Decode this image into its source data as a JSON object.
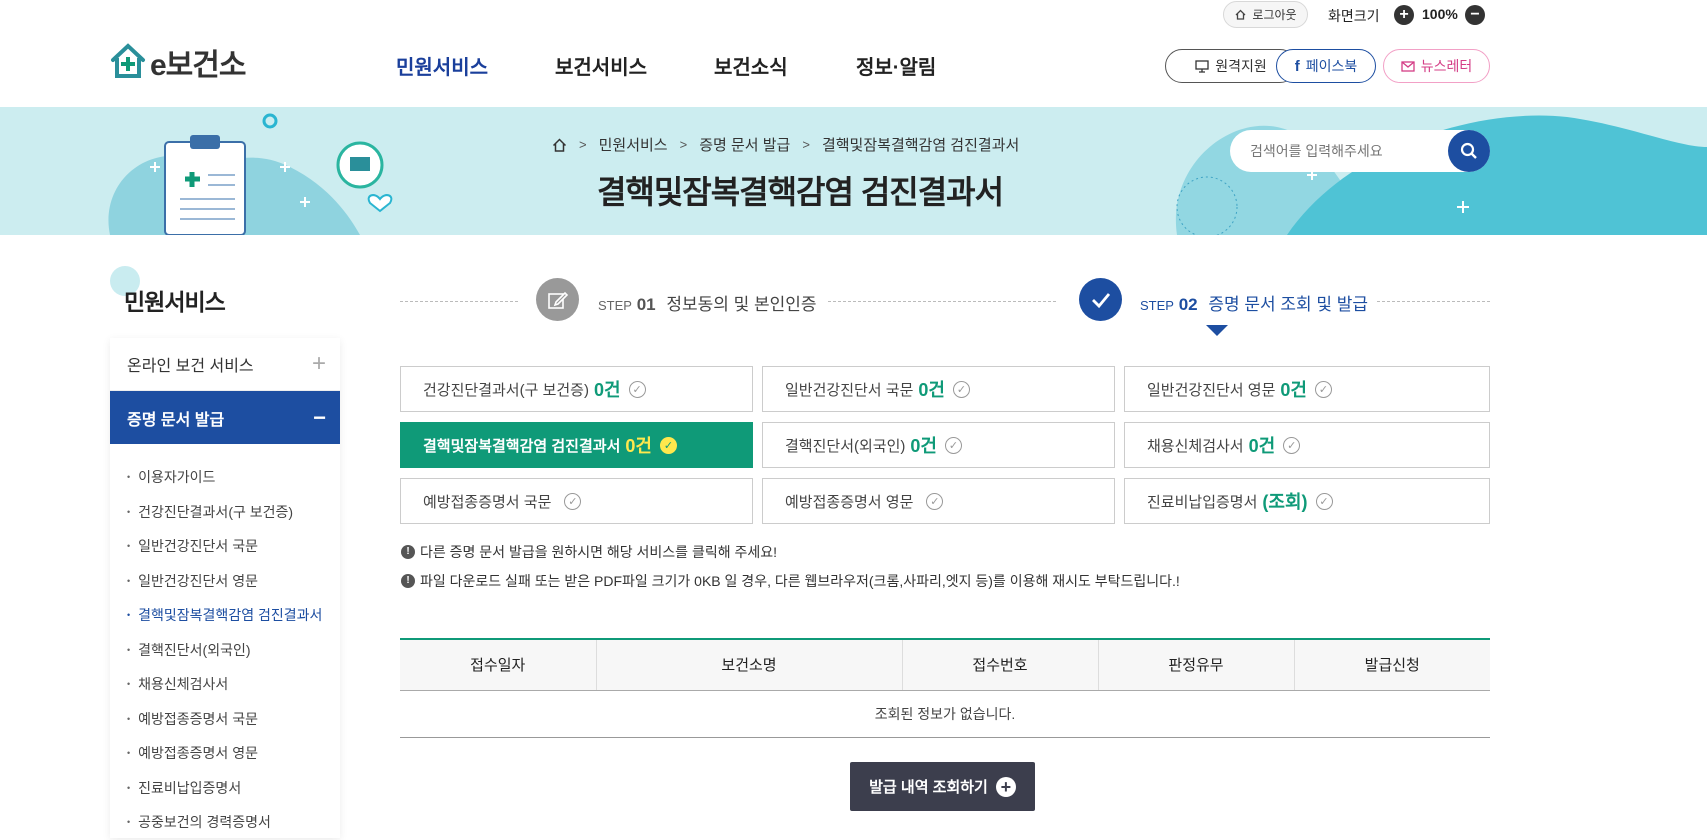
{
  "util": {
    "logout": "로그아웃",
    "screen_size": "화면크기",
    "zoom": "100%"
  },
  "logo": {
    "text": "e보건소"
  },
  "gnb": [
    "민원서비스",
    "보건서비스",
    "보건소식",
    "정보·알림"
  ],
  "header_buttons": {
    "remote": "원격지원",
    "facebook": "페이스북",
    "newsletter": "뉴스레터"
  },
  "breadcrumb": [
    "민원서비스",
    "증명 문서 발급",
    "결핵및잠복결핵감염 검진결과서"
  ],
  "page_title": "결핵및잠복결핵감염 검진결과서",
  "search": {
    "placeholder": "검색어를 입력해주세요"
  },
  "sidebar": {
    "title": "민원서비스",
    "sections": [
      {
        "label": "온라인 보건 서비스",
        "toggle": "+"
      },
      {
        "label": "증명 문서 발급",
        "toggle": "−"
      }
    ],
    "items": [
      "이용자가이드",
      "건강진단결과서(구 보건증)",
      "일반건강진단서 국문",
      "일반건강진단서 영문",
      "결핵및잠복결핵감염 검진결과서",
      "결핵진단서(외국인)",
      "채용신체검사서",
      "예방접종증명서 국문",
      "예방접종증명서 영문",
      "진료비납입증명서",
      "공중보건의 경력증명서"
    ]
  },
  "steps": [
    {
      "step": "STEP",
      "num": "01",
      "label": "정보동의 및 본인인증"
    },
    {
      "step": "STEP",
      "num": "02",
      "label": "증명 문서 조회 및 발급"
    }
  ],
  "docs": [
    {
      "label": "건강진단결과서(구 보건증)",
      "count": "0건"
    },
    {
      "label": "일반건강진단서 국문",
      "count": "0건"
    },
    {
      "label": "일반건강진단서 영문",
      "count": "0건"
    },
    {
      "label": "결핵및잠복결핵감염 검진결과서",
      "count": "0건"
    },
    {
      "label": "결핵진단서(외국인)",
      "count": "0건"
    },
    {
      "label": "채용신체검사서",
      "count": "0건"
    },
    {
      "label": "예방접종증명서 국문",
      "count": ""
    },
    {
      "label": "예방접종증명서 영문",
      "count": ""
    },
    {
      "label": "진료비납입증명서",
      "count": "(조회)"
    }
  ],
  "notices": [
    "다른 증명 문서 발급을 원하시면 해당 서비스를 클릭해 주세요!",
    "파일 다운로드 실패 또는 받은 PDF파일 크기가 0KB 일 경우, 다른 웹브라우저(크롬,사파리,엣지 등)를 이용해 재시도 부탁드립니다.!"
  ],
  "table": {
    "headers": [
      "접수일자",
      "보건소명",
      "접수번호",
      "판정유무",
      "발급신청"
    ],
    "empty": "조회된 정보가 없습니다."
  },
  "issue_button": "발급 내역 조회하기",
  "colors": {
    "primary": "#1d4ea1",
    "accent": "#0f9a78",
    "banner": "#ccedf0",
    "highlight": "#ffe84d"
  }
}
